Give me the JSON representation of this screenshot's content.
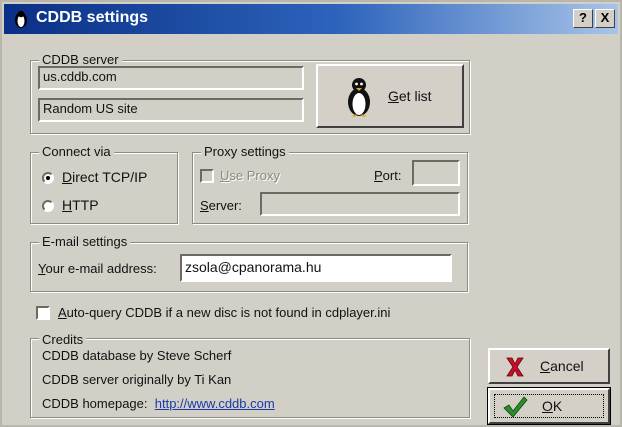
{
  "window": {
    "title": "CDDB settings",
    "help_label": "?",
    "close_label": "X"
  },
  "cddb_server": {
    "label": "CDDB server",
    "server_value": "us.cddb.com",
    "site_value": "Random US site",
    "get_list_key": "G",
    "get_list_rest": "et list"
  },
  "connect_via": {
    "label": "Connect via",
    "direct_key": "D",
    "direct_rest": "irect TCP/IP",
    "http_key": "H",
    "http_rest": "TTP",
    "selected": "Direct TCP/IP"
  },
  "proxy": {
    "label": "Proxy settings",
    "use_proxy_key": "U",
    "use_proxy_rest": "se Proxy",
    "port_key": "P",
    "port_rest": "ort:",
    "server_key": "S",
    "server_rest": "erver:",
    "port_value": "",
    "server_value": ""
  },
  "email": {
    "label": "E-mail settings",
    "address_key": "Y",
    "address_rest": "our e-mail address:",
    "value": "zsola@cpanorama.hu"
  },
  "auto_query": {
    "key": "A",
    "rest": "uto-query CDDB if a new disc is not found in cdplayer.ini",
    "checked": false
  },
  "credits": {
    "label": "Credits",
    "line1": "CDDB database by Steve Scherf",
    "line2": "CDDB server originally by Ti Kan",
    "line3_prefix": "CDDB homepage:",
    "homepage_link": "http://www.cddb.com"
  },
  "buttons": {
    "cancel_key": "C",
    "cancel_rest": "ancel",
    "ok_key": "O",
    "ok_rest": "K"
  },
  "colors": {
    "titlebar_start": "#0a2f86",
    "titlebar_end": "#a8c4e8",
    "dialog_bg": "#d2d0c6",
    "link": "#1b3aa8",
    "cancel_icon": "#c8102e",
    "ok_icon": "#2e8b2e"
  }
}
